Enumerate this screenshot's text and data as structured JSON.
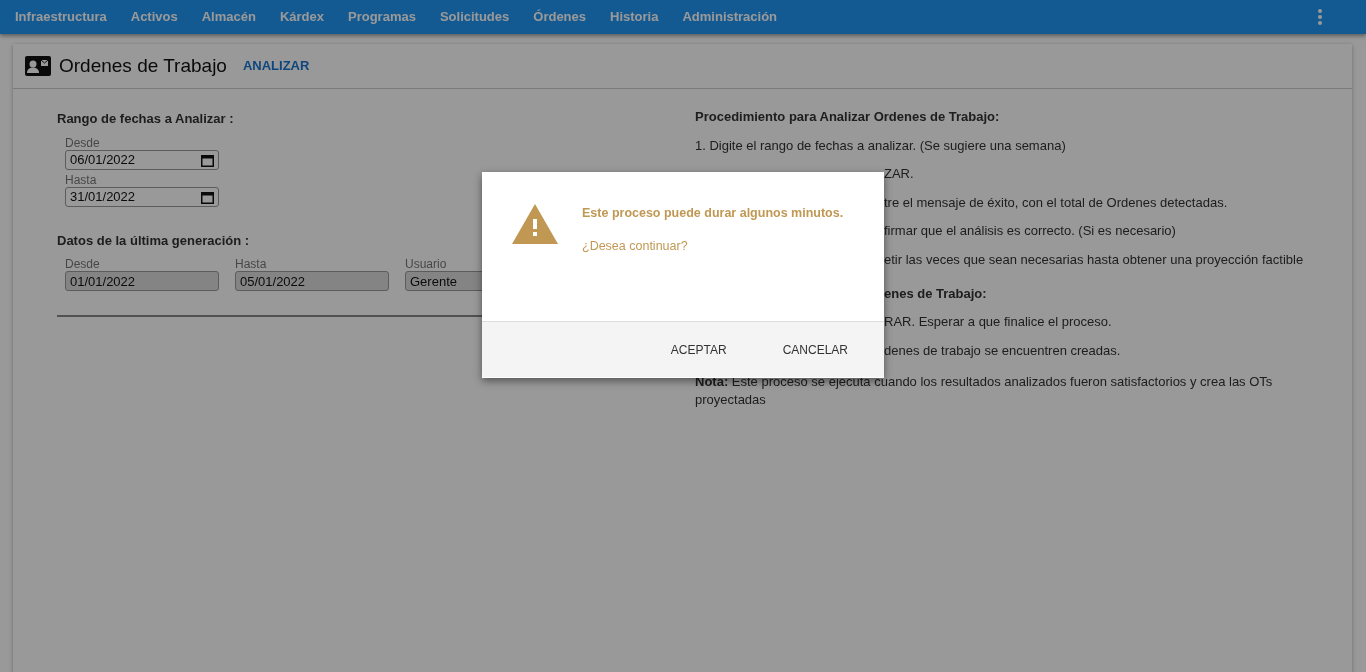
{
  "nav": {
    "items": [
      "Infraestructura",
      "Activos",
      "Almacén",
      "Kárdex",
      "Programas",
      "Solicitudes",
      "Órdenes",
      "Historia",
      "Administración"
    ]
  },
  "page": {
    "title": "Ordenes de Trabajo",
    "action": "ANALIZAR"
  },
  "date_range": {
    "heading": "Rango de fechas a Analizar :",
    "fields": [
      {
        "label": "Desde",
        "value": "06/01/2022",
        "disabled": false
      },
      {
        "label": "Hasta",
        "value": "31/01/2022",
        "disabled": false
      }
    ]
  },
  "last_generation": {
    "heading": "Datos de la última generación :",
    "fields": [
      {
        "label": "Desde",
        "value": "01/01/2022",
        "disabled": true
      },
      {
        "label": "Hasta",
        "value": "05/01/2022",
        "disabled": true
      },
      {
        "label": "Usuario",
        "value": "Gerente",
        "disabled": true
      }
    ]
  },
  "procedure": [
    {
      "kind": "heading",
      "text": "Procedimiento para Analizar Ordenes de Trabajo:"
    },
    {
      "kind": "step",
      "text": "1. Digite el rango de fechas a analizar. (Se sugiere una semana)"
    },
    {
      "kind": "fragment",
      "text": "ZAR."
    },
    {
      "kind": "fragment",
      "text": "tre el mensaje de éxito, con el total de Ordenes detectadas."
    },
    {
      "kind": "fragment",
      "text": "firmar que el análisis es correcto. (Si es necesario)"
    },
    {
      "kind": "fragment",
      "text": "etir las veces que sean necesarias hasta obtener una proyección factible"
    },
    {
      "kind": "fragment-heading",
      "text": "enes de Trabajo:"
    },
    {
      "kind": "fragment",
      "text": "RAR. Esperar a que finalice el proceso."
    },
    {
      "kind": "fragment",
      "text": "denes de trabajo se encuentren creadas."
    },
    {
      "kind": "note",
      "text": "**Nota:** Este proceso se ejecuta cuando los resultados analizados fueron satisfactorios y crea las OTs proyectadas"
    }
  ],
  "dialog": {
    "message": "Este proceso puede durar algunos minutos.",
    "question": "¿Desea continuar?",
    "buttons": [
      "ACEPTAR",
      "CANCELAR"
    ]
  }
}
